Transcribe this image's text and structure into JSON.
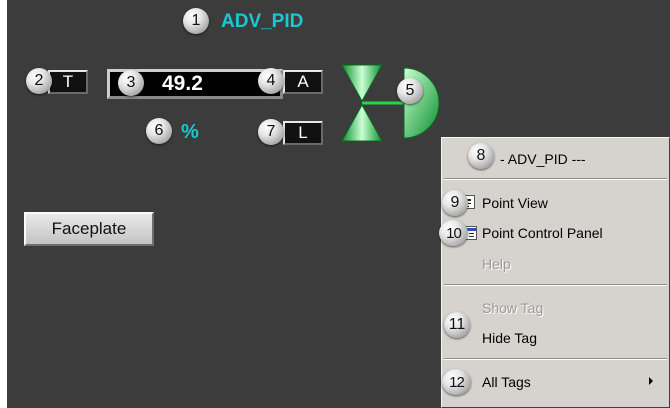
{
  "display": {
    "title": "ADV_PID",
    "track_label": "T",
    "pv_value": "49.2",
    "mode_label": "A",
    "units": "%",
    "local_label": "L",
    "faceplate_label": "Faceplate"
  },
  "callouts": [
    "1",
    "2",
    "3",
    "4",
    "5",
    "6",
    "7",
    "8",
    "9",
    "10",
    "11",
    "12"
  ],
  "context_menu": {
    "header": "- ADV_PID ---",
    "items": [
      {
        "label": "Point View",
        "enabled": true,
        "icon": "point-view-icon"
      },
      {
        "label": "Point Control Panel",
        "enabled": true,
        "icon": "control-panel-icon"
      },
      {
        "label": "Help",
        "enabled": false
      },
      {
        "label": "Show Tag",
        "enabled": false
      },
      {
        "label": "Hide Tag",
        "enabled": true
      },
      {
        "label": "All Tags",
        "enabled": true,
        "submenu": true
      }
    ]
  },
  "colors": {
    "background": "#3c3c3c",
    "accent_cyan": "#19c8d2",
    "valve_green": "#1fd84a",
    "menu_bg": "#d6d3ce"
  }
}
